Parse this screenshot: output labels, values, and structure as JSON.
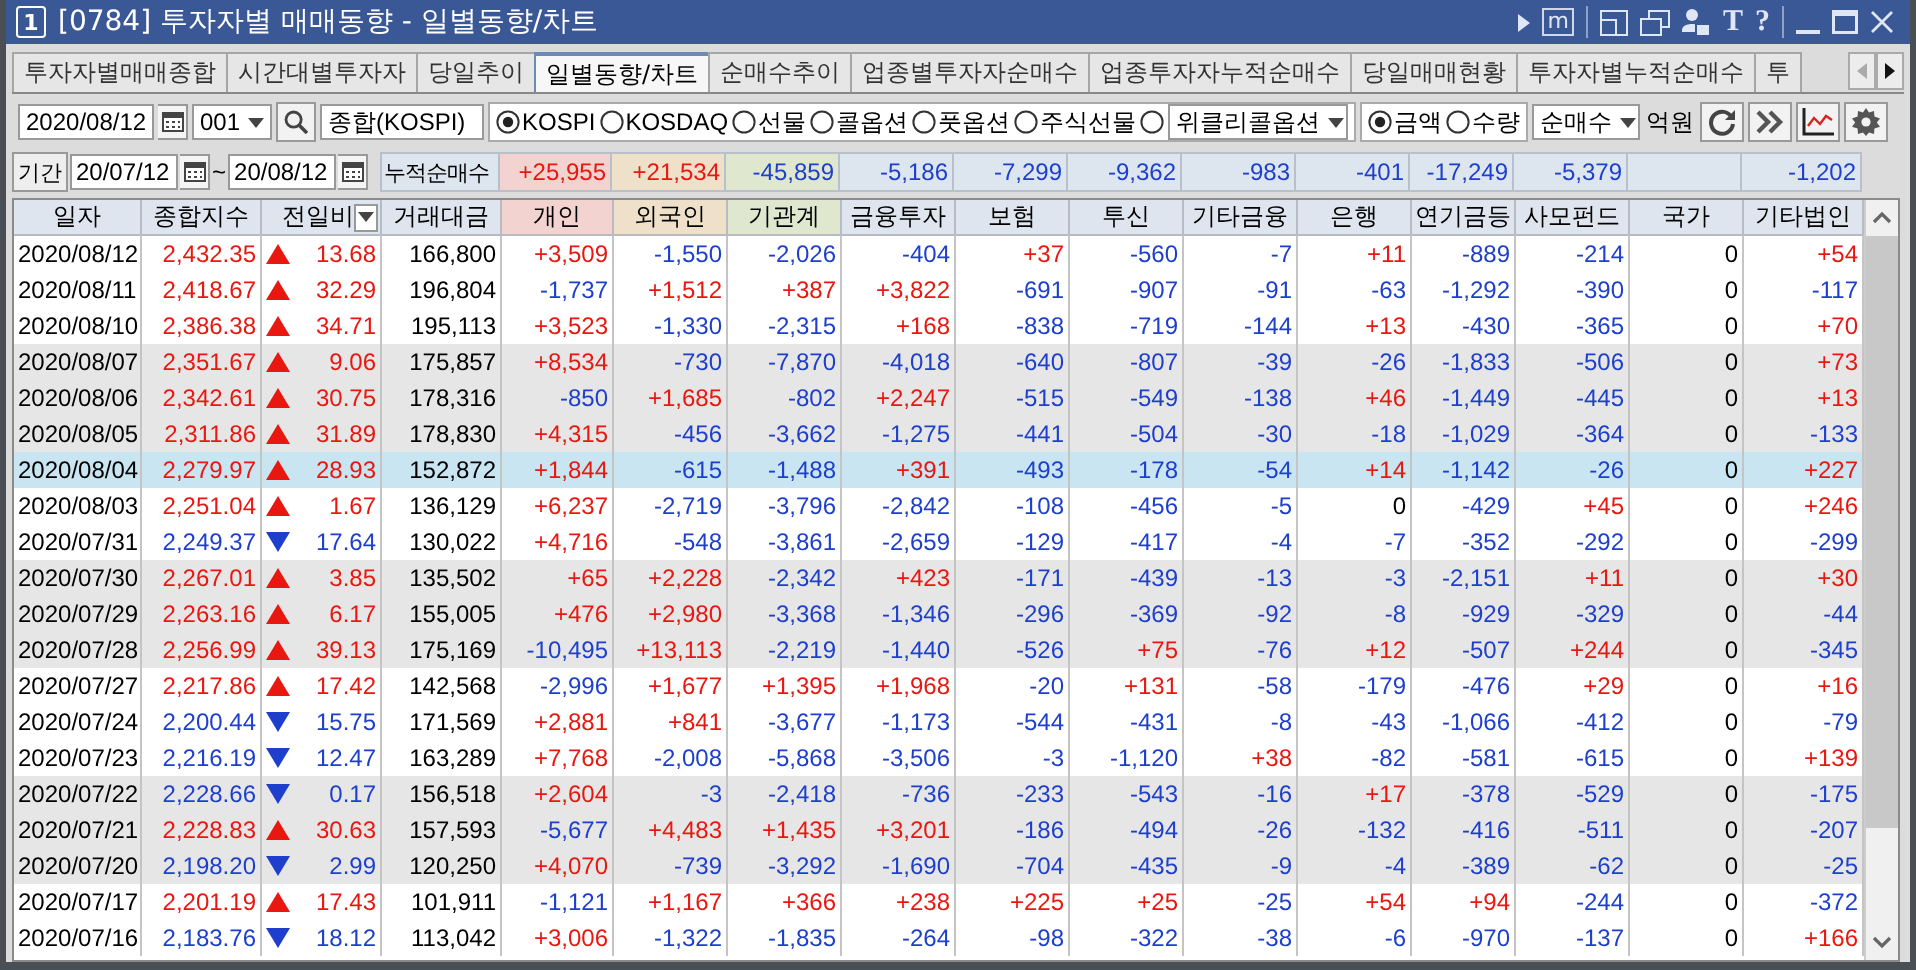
{
  "window": {
    "number": "1",
    "title": "[0784] 투자자별 매매동향 - 일별동향/차트",
    "memo_key": "m",
    "font_key": "T",
    "help_key": "?"
  },
  "tabs": [
    {
      "label": "투자자별매매종합",
      "selected": false
    },
    {
      "label": "시간대별투자자",
      "selected": false
    },
    {
      "label": "당일추이",
      "selected": false
    },
    {
      "label": "일별동향/차트",
      "selected": true
    },
    {
      "label": "순매수추이",
      "selected": false
    },
    {
      "label": "업종별투자자순매수",
      "selected": false
    },
    {
      "label": "업종투자자누적순매수",
      "selected": false
    },
    {
      "label": "당일매매현황",
      "selected": false
    },
    {
      "label": "투자자별누적순매수",
      "selected": false
    },
    {
      "label": "투",
      "selected": false
    }
  ],
  "tab_arrows": [
    {
      "kind": "left",
      "disabled": true
    },
    {
      "kind": "right",
      "disabled": false
    }
  ],
  "toolbar": {
    "date": "2020/08/12",
    "code": "001",
    "market_name": "종합(KOSPI)",
    "markets": [
      {
        "label": "KOSPI",
        "selected": true
      },
      {
        "label": "KOSDAQ",
        "selected": false
      },
      {
        "label": "선물",
        "selected": false
      },
      {
        "label": "콜옵션",
        "selected": false
      },
      {
        "label": "풋옵션",
        "selected": false
      },
      {
        "label": "주식선물",
        "selected": false
      }
    ],
    "extra_market": {
      "selected": false,
      "value": "위클리콜옵션"
    },
    "units": [
      {
        "label": "금액",
        "selected": true
      },
      {
        "label": "수량",
        "selected": false
      }
    ],
    "mode": "순매수",
    "unit_label": "억원"
  },
  "period": {
    "label": "기간",
    "from": "20/07/12",
    "separator": "~",
    "to": "20/08/12"
  },
  "summary": {
    "label": "누적순매수",
    "values": [
      {
        "text": "+25,955",
        "kind": "gain"
      },
      {
        "text": "+21,534",
        "kind": "gain"
      },
      {
        "text": "-45,859",
        "kind": "loss"
      },
      {
        "text": "-5,186",
        "kind": "loss"
      },
      {
        "text": "-7,299",
        "kind": "loss"
      },
      {
        "text": "-9,362",
        "kind": "loss"
      },
      {
        "text": "-983",
        "kind": "loss"
      },
      {
        "text": "-401",
        "kind": "loss"
      },
      {
        "text": "-17,249",
        "kind": "loss"
      },
      {
        "text": "-5,379",
        "kind": "loss"
      },
      {
        "kind": "blank"
      },
      {
        "text": "-1,202",
        "kind": "loss"
      }
    ]
  },
  "table": {
    "columns": [
      {
        "label": "일자",
        "kind": "plain"
      },
      {
        "label": "종합지수",
        "kind": "plain"
      },
      {
        "label": "전일비",
        "kind": "menu"
      },
      {
        "label": "거래대금",
        "kind": "plain"
      },
      {
        "label": "개인",
        "kind": "plain",
        "color": "#f3d3cf"
      },
      {
        "label": "외국인",
        "kind": "plain",
        "color": "#efe1c9"
      },
      {
        "label": "기관계",
        "kind": "plain",
        "color": "#dfe7cf"
      },
      {
        "label": "금융투자",
        "kind": "plain"
      },
      {
        "label": "보험",
        "kind": "plain"
      },
      {
        "label": "투신",
        "kind": "plain"
      },
      {
        "label": "기타금융",
        "kind": "plain"
      },
      {
        "label": "은행",
        "kind": "plain"
      },
      {
        "label": "연기금등",
        "kind": "plain"
      },
      {
        "label": "사모펀드",
        "kind": "plain"
      },
      {
        "label": "국가",
        "kind": "plain"
      },
      {
        "label": "기타법인",
        "kind": "plain"
      }
    ],
    "rows": [
      {
        "date": "2020/08/12",
        "index": "2,432.35",
        "kind": "rise",
        "change": "13.68",
        "volume": "166,800",
        "selected": false,
        "flows": [
          {
            "text": "+3,509",
            "kind": "gain"
          },
          {
            "text": "-1,550",
            "kind": "loss"
          },
          {
            "text": "-2,026",
            "kind": "loss"
          },
          {
            "text": "-404",
            "kind": "loss"
          },
          {
            "text": "+37",
            "kind": "gain"
          },
          {
            "text": "-560",
            "kind": "loss"
          },
          {
            "text": "-7",
            "kind": "loss"
          },
          {
            "text": "+11",
            "kind": "gain"
          },
          {
            "text": "-889",
            "kind": "loss"
          },
          {
            "text": "-214",
            "kind": "loss"
          },
          {
            "text": "0",
            "kind": "even"
          },
          {
            "text": "+54",
            "kind": "gain"
          }
        ]
      },
      {
        "date": "2020/08/11",
        "index": "2,418.67",
        "kind": "rise",
        "change": "32.29",
        "volume": "196,804",
        "selected": false,
        "flows": [
          {
            "text": "-1,737",
            "kind": "loss"
          },
          {
            "text": "+1,512",
            "kind": "gain"
          },
          {
            "text": "+387",
            "kind": "gain"
          },
          {
            "text": "+3,822",
            "kind": "gain"
          },
          {
            "text": "-691",
            "kind": "loss"
          },
          {
            "text": "-907",
            "kind": "loss"
          },
          {
            "text": "-91",
            "kind": "loss"
          },
          {
            "text": "-63",
            "kind": "loss"
          },
          {
            "text": "-1,292",
            "kind": "loss"
          },
          {
            "text": "-390",
            "kind": "loss"
          },
          {
            "text": "0",
            "kind": "even"
          },
          {
            "text": "-117",
            "kind": "loss"
          }
        ]
      },
      {
        "date": "2020/08/10",
        "index": "2,386.38",
        "kind": "rise",
        "change": "34.71",
        "volume": "195,113",
        "selected": false,
        "flows": [
          {
            "text": "+3,523",
            "kind": "gain"
          },
          {
            "text": "-1,330",
            "kind": "loss"
          },
          {
            "text": "-2,315",
            "kind": "loss"
          },
          {
            "text": "+168",
            "kind": "gain"
          },
          {
            "text": "-838",
            "kind": "loss"
          },
          {
            "text": "-719",
            "kind": "loss"
          },
          {
            "text": "-144",
            "kind": "loss"
          },
          {
            "text": "+13",
            "kind": "gain"
          },
          {
            "text": "-430",
            "kind": "loss"
          },
          {
            "text": "-365",
            "kind": "loss"
          },
          {
            "text": "0",
            "kind": "even"
          },
          {
            "text": "+70",
            "kind": "gain"
          }
        ]
      },
      {
        "date": "2020/08/07",
        "index": "2,351.67",
        "kind": "rise",
        "change": "9.06",
        "volume": "175,857",
        "selected": false,
        "flows": [
          {
            "text": "+8,534",
            "kind": "gain"
          },
          {
            "text": "-730",
            "kind": "loss"
          },
          {
            "text": "-7,870",
            "kind": "loss"
          },
          {
            "text": "-4,018",
            "kind": "loss"
          },
          {
            "text": "-640",
            "kind": "loss"
          },
          {
            "text": "-807",
            "kind": "loss"
          },
          {
            "text": "-39",
            "kind": "loss"
          },
          {
            "text": "-26",
            "kind": "loss"
          },
          {
            "text": "-1,833",
            "kind": "loss"
          },
          {
            "text": "-506",
            "kind": "loss"
          },
          {
            "text": "0",
            "kind": "even"
          },
          {
            "text": "+73",
            "kind": "gain"
          }
        ]
      },
      {
        "date": "2020/08/06",
        "index": "2,342.61",
        "kind": "rise",
        "change": "30.75",
        "volume": "178,316",
        "selected": false,
        "flows": [
          {
            "text": "-850",
            "kind": "loss"
          },
          {
            "text": "+1,685",
            "kind": "gain"
          },
          {
            "text": "-802",
            "kind": "loss"
          },
          {
            "text": "+2,247",
            "kind": "gain"
          },
          {
            "text": "-515",
            "kind": "loss"
          },
          {
            "text": "-549",
            "kind": "loss"
          },
          {
            "text": "-138",
            "kind": "loss"
          },
          {
            "text": "+46",
            "kind": "gain"
          },
          {
            "text": "-1,449",
            "kind": "loss"
          },
          {
            "text": "-445",
            "kind": "loss"
          },
          {
            "text": "0",
            "kind": "even"
          },
          {
            "text": "+13",
            "kind": "gain"
          }
        ]
      },
      {
        "date": "2020/08/05",
        "index": "2,311.86",
        "kind": "rise",
        "change": "31.89",
        "volume": "178,830",
        "selected": false,
        "flows": [
          {
            "text": "+4,315",
            "kind": "gain"
          },
          {
            "text": "-456",
            "kind": "loss"
          },
          {
            "text": "-3,662",
            "kind": "loss"
          },
          {
            "text": "-1,275",
            "kind": "loss"
          },
          {
            "text": "-441",
            "kind": "loss"
          },
          {
            "text": "-504",
            "kind": "loss"
          },
          {
            "text": "-30",
            "kind": "loss"
          },
          {
            "text": "-18",
            "kind": "loss"
          },
          {
            "text": "-1,029",
            "kind": "loss"
          },
          {
            "text": "-364",
            "kind": "loss"
          },
          {
            "text": "0",
            "kind": "even"
          },
          {
            "text": "-133",
            "kind": "loss"
          }
        ]
      },
      {
        "date": "2020/08/04",
        "index": "2,279.97",
        "kind": "rise",
        "change": "28.93",
        "volume": "152,872",
        "selected": true,
        "flows": [
          {
            "text": "+1,844",
            "kind": "gain"
          },
          {
            "text": "-615",
            "kind": "loss"
          },
          {
            "text": "-1,488",
            "kind": "loss"
          },
          {
            "text": "+391",
            "kind": "gain"
          },
          {
            "text": "-493",
            "kind": "loss"
          },
          {
            "text": "-178",
            "kind": "loss"
          },
          {
            "text": "-54",
            "kind": "loss"
          },
          {
            "text": "+14",
            "kind": "gain"
          },
          {
            "text": "-1,142",
            "kind": "loss"
          },
          {
            "text": "-26",
            "kind": "loss"
          },
          {
            "text": "0",
            "kind": "even"
          },
          {
            "text": "+227",
            "kind": "gain"
          }
        ]
      },
      {
        "date": "2020/08/03",
        "index": "2,251.04",
        "kind": "rise",
        "change": "1.67",
        "volume": "136,129",
        "selected": false,
        "flows": [
          {
            "text": "+6,237",
            "kind": "gain"
          },
          {
            "text": "-2,719",
            "kind": "loss"
          },
          {
            "text": "-3,796",
            "kind": "loss"
          },
          {
            "text": "-2,842",
            "kind": "loss"
          },
          {
            "text": "-108",
            "kind": "loss"
          },
          {
            "text": "-456",
            "kind": "loss"
          },
          {
            "text": "-5",
            "kind": "loss"
          },
          {
            "text": "0",
            "kind": "even"
          },
          {
            "text": "-429",
            "kind": "loss"
          },
          {
            "text": "+45",
            "kind": "gain"
          },
          {
            "text": "0",
            "kind": "even"
          },
          {
            "text": "+246",
            "kind": "gain"
          }
        ]
      },
      {
        "date": "2020/07/31",
        "index": "2,249.37",
        "kind": "fall",
        "change": "17.64",
        "volume": "130,022",
        "selected": false,
        "flows": [
          {
            "text": "+4,716",
            "kind": "gain"
          },
          {
            "text": "-548",
            "kind": "loss"
          },
          {
            "text": "-3,861",
            "kind": "loss"
          },
          {
            "text": "-2,659",
            "kind": "loss"
          },
          {
            "text": "-129",
            "kind": "loss"
          },
          {
            "text": "-417",
            "kind": "loss"
          },
          {
            "text": "-4",
            "kind": "loss"
          },
          {
            "text": "-7",
            "kind": "loss"
          },
          {
            "text": "-352",
            "kind": "loss"
          },
          {
            "text": "-292",
            "kind": "loss"
          },
          {
            "text": "0",
            "kind": "even"
          },
          {
            "text": "-299",
            "kind": "loss"
          }
        ]
      },
      {
        "date": "2020/07/30",
        "index": "2,267.01",
        "kind": "rise",
        "change": "3.85",
        "volume": "135,502",
        "selected": false,
        "flows": [
          {
            "text": "+65",
            "kind": "gain"
          },
          {
            "text": "+2,228",
            "kind": "gain"
          },
          {
            "text": "-2,342",
            "kind": "loss"
          },
          {
            "text": "+423",
            "kind": "gain"
          },
          {
            "text": "-171",
            "kind": "loss"
          },
          {
            "text": "-439",
            "kind": "loss"
          },
          {
            "text": "-13",
            "kind": "loss"
          },
          {
            "text": "-3",
            "kind": "loss"
          },
          {
            "text": "-2,151",
            "kind": "loss"
          },
          {
            "text": "+11",
            "kind": "gain"
          },
          {
            "text": "0",
            "kind": "even"
          },
          {
            "text": "+30",
            "kind": "gain"
          }
        ]
      },
      {
        "date": "2020/07/29",
        "index": "2,263.16",
        "kind": "rise",
        "change": "6.17",
        "volume": "155,005",
        "selected": false,
        "flows": [
          {
            "text": "+476",
            "kind": "gain"
          },
          {
            "text": "+2,980",
            "kind": "gain"
          },
          {
            "text": "-3,368",
            "kind": "loss"
          },
          {
            "text": "-1,346",
            "kind": "loss"
          },
          {
            "text": "-296",
            "kind": "loss"
          },
          {
            "text": "-369",
            "kind": "loss"
          },
          {
            "text": "-92",
            "kind": "loss"
          },
          {
            "text": "-8",
            "kind": "loss"
          },
          {
            "text": "-929",
            "kind": "loss"
          },
          {
            "text": "-329",
            "kind": "loss"
          },
          {
            "text": "0",
            "kind": "even"
          },
          {
            "text": "-44",
            "kind": "loss"
          }
        ]
      },
      {
        "date": "2020/07/28",
        "index": "2,256.99",
        "kind": "rise",
        "change": "39.13",
        "volume": "175,169",
        "selected": false,
        "flows": [
          {
            "text": "-10,495",
            "kind": "loss"
          },
          {
            "text": "+13,113",
            "kind": "gain"
          },
          {
            "text": "-2,219",
            "kind": "loss"
          },
          {
            "text": "-1,440",
            "kind": "loss"
          },
          {
            "text": "-526",
            "kind": "loss"
          },
          {
            "text": "+75",
            "kind": "gain"
          },
          {
            "text": "-76",
            "kind": "loss"
          },
          {
            "text": "+12",
            "kind": "gain"
          },
          {
            "text": "-507",
            "kind": "loss"
          },
          {
            "text": "+244",
            "kind": "gain"
          },
          {
            "text": "0",
            "kind": "even"
          },
          {
            "text": "-345",
            "kind": "loss"
          }
        ]
      },
      {
        "date": "2020/07/27",
        "index": "2,217.86",
        "kind": "rise",
        "change": "17.42",
        "volume": "142,568",
        "selected": false,
        "flows": [
          {
            "text": "-2,996",
            "kind": "loss"
          },
          {
            "text": "+1,677",
            "kind": "gain"
          },
          {
            "text": "+1,395",
            "kind": "gain"
          },
          {
            "text": "+1,968",
            "kind": "gain"
          },
          {
            "text": "-20",
            "kind": "loss"
          },
          {
            "text": "+131",
            "kind": "gain"
          },
          {
            "text": "-58",
            "kind": "loss"
          },
          {
            "text": "-179",
            "kind": "loss"
          },
          {
            "text": "-476",
            "kind": "loss"
          },
          {
            "text": "+29",
            "kind": "gain"
          },
          {
            "text": "0",
            "kind": "even"
          },
          {
            "text": "+16",
            "kind": "gain"
          }
        ]
      },
      {
        "date": "2020/07/24",
        "index": "2,200.44",
        "kind": "fall",
        "change": "15.75",
        "volume": "171,569",
        "selected": false,
        "flows": [
          {
            "text": "+2,881",
            "kind": "gain"
          },
          {
            "text": "+841",
            "kind": "gain"
          },
          {
            "text": "-3,677",
            "kind": "loss"
          },
          {
            "text": "-1,173",
            "kind": "loss"
          },
          {
            "text": "-544",
            "kind": "loss"
          },
          {
            "text": "-431",
            "kind": "loss"
          },
          {
            "text": "-8",
            "kind": "loss"
          },
          {
            "text": "-43",
            "kind": "loss"
          },
          {
            "text": "-1,066",
            "kind": "loss"
          },
          {
            "text": "-412",
            "kind": "loss"
          },
          {
            "text": "0",
            "kind": "even"
          },
          {
            "text": "-79",
            "kind": "loss"
          }
        ]
      },
      {
        "date": "2020/07/23",
        "index": "2,216.19",
        "kind": "fall",
        "change": "12.47",
        "volume": "163,289",
        "selected": false,
        "flows": [
          {
            "text": "+7,768",
            "kind": "gain"
          },
          {
            "text": "-2,008",
            "kind": "loss"
          },
          {
            "text": "-5,868",
            "kind": "loss"
          },
          {
            "text": "-3,506",
            "kind": "loss"
          },
          {
            "text": "-3",
            "kind": "loss"
          },
          {
            "text": "-1,120",
            "kind": "loss"
          },
          {
            "text": "+38",
            "kind": "gain"
          },
          {
            "text": "-82",
            "kind": "loss"
          },
          {
            "text": "-581",
            "kind": "loss"
          },
          {
            "text": "-615",
            "kind": "loss"
          },
          {
            "text": "0",
            "kind": "even"
          },
          {
            "text": "+139",
            "kind": "gain"
          }
        ]
      },
      {
        "date": "2020/07/22",
        "index": "2,228.66",
        "kind": "fall",
        "change": "0.17",
        "volume": "156,518",
        "selected": false,
        "flows": [
          {
            "text": "+2,604",
            "kind": "gain"
          },
          {
            "text": "-3",
            "kind": "loss"
          },
          {
            "text": "-2,418",
            "kind": "loss"
          },
          {
            "text": "-736",
            "kind": "loss"
          },
          {
            "text": "-233",
            "kind": "loss"
          },
          {
            "text": "-543",
            "kind": "loss"
          },
          {
            "text": "-16",
            "kind": "loss"
          },
          {
            "text": "+17",
            "kind": "gain"
          },
          {
            "text": "-378",
            "kind": "loss"
          },
          {
            "text": "-529",
            "kind": "loss"
          },
          {
            "text": "0",
            "kind": "even"
          },
          {
            "text": "-175",
            "kind": "loss"
          }
        ]
      },
      {
        "date": "2020/07/21",
        "index": "2,228.83",
        "kind": "rise",
        "change": "30.63",
        "volume": "157,593",
        "selected": false,
        "flows": [
          {
            "text": "-5,677",
            "kind": "loss"
          },
          {
            "text": "+4,483",
            "kind": "gain"
          },
          {
            "text": "+1,435",
            "kind": "gain"
          },
          {
            "text": "+3,201",
            "kind": "gain"
          },
          {
            "text": "-186",
            "kind": "loss"
          },
          {
            "text": "-494",
            "kind": "loss"
          },
          {
            "text": "-26",
            "kind": "loss"
          },
          {
            "text": "-132",
            "kind": "loss"
          },
          {
            "text": "-416",
            "kind": "loss"
          },
          {
            "text": "-511",
            "kind": "loss"
          },
          {
            "text": "0",
            "kind": "even"
          },
          {
            "text": "-207",
            "kind": "loss"
          }
        ]
      },
      {
        "date": "2020/07/20",
        "index": "2,198.20",
        "kind": "fall",
        "change": "2.99",
        "volume": "120,250",
        "selected": false,
        "flows": [
          {
            "text": "+4,070",
            "kind": "gain"
          },
          {
            "text": "-739",
            "kind": "loss"
          },
          {
            "text": "-3,292",
            "kind": "loss"
          },
          {
            "text": "-1,690",
            "kind": "loss"
          },
          {
            "text": "-704",
            "kind": "loss"
          },
          {
            "text": "-435",
            "kind": "loss"
          },
          {
            "text": "-9",
            "kind": "loss"
          },
          {
            "text": "-4",
            "kind": "loss"
          },
          {
            "text": "-389",
            "kind": "loss"
          },
          {
            "text": "-62",
            "kind": "loss"
          },
          {
            "text": "0",
            "kind": "even"
          },
          {
            "text": "-25",
            "kind": "loss"
          }
        ]
      },
      {
        "date": "2020/07/17",
        "index": "2,201.19",
        "kind": "rise",
        "change": "17.43",
        "volume": "101,911",
        "selected": false,
        "flows": [
          {
            "text": "-1,121",
            "kind": "loss"
          },
          {
            "text": "+1,167",
            "kind": "gain"
          },
          {
            "text": "+366",
            "kind": "gain"
          },
          {
            "text": "+238",
            "kind": "gain"
          },
          {
            "text": "+225",
            "kind": "gain"
          },
          {
            "text": "+25",
            "kind": "gain"
          },
          {
            "text": "-25",
            "kind": "loss"
          },
          {
            "text": "+54",
            "kind": "gain"
          },
          {
            "text": "+94",
            "kind": "gain"
          },
          {
            "text": "-244",
            "kind": "loss"
          },
          {
            "text": "0",
            "kind": "even"
          },
          {
            "text": "-372",
            "kind": "loss"
          }
        ]
      },
      {
        "date": "2020/07/16",
        "index": "2,183.76",
        "kind": "fall",
        "change": "18.12",
        "volume": "113,042",
        "selected": false,
        "flows": [
          {
            "text": "+3,006",
            "kind": "gain"
          },
          {
            "text": "-1,322",
            "kind": "loss"
          },
          {
            "text": "-1,835",
            "kind": "loss"
          },
          {
            "text": "-264",
            "kind": "loss"
          },
          {
            "text": "-98",
            "kind": "loss"
          },
          {
            "text": "-322",
            "kind": "loss"
          },
          {
            "text": "-38",
            "kind": "loss"
          },
          {
            "text": "-6",
            "kind": "loss"
          },
          {
            "text": "-970",
            "kind": "loss"
          },
          {
            "text": "-137",
            "kind": "loss"
          },
          {
            "text": "0",
            "kind": "even"
          },
          {
            "text": "+166",
            "kind": "gain"
          }
        ]
      }
    ]
  }
}
